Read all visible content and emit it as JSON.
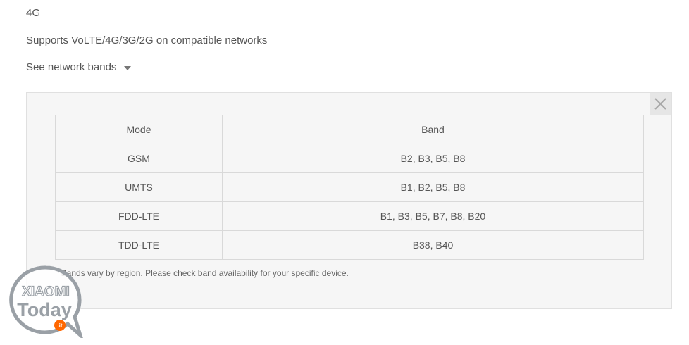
{
  "network": {
    "title": "4G",
    "description": "Supports VoLTE/4G/3G/2G on compatible networks",
    "toggle_label": "See network bands"
  },
  "bands_table": {
    "headers": {
      "mode": "Mode",
      "band": "Band"
    },
    "rows": [
      {
        "mode": "GSM",
        "band": "B2, B3, B5, B8"
      },
      {
        "mode": "UMTS",
        "band": "B1, B2, B5, B8"
      },
      {
        "mode": "FDD-LTE",
        "band": "B1, B3, B5, B7, B8, B20"
      },
      {
        "mode": "TDD-LTE",
        "band": "B38, B40"
      }
    ],
    "note": "*Bands vary by region. Please check band availability for your specific device."
  },
  "icons": {
    "close": "close-icon",
    "toggle": "caret-down-icon"
  },
  "watermark": {
    "line1": "XIAOMI",
    "line2": "Today",
    "line3": ".it"
  },
  "colors": {
    "panel_bg": "#f6f6f6",
    "border": "#d9d9d9",
    "text": "#555555",
    "logo_ring": "#9aa0a6",
    "logo_dot": "#ff6700"
  }
}
